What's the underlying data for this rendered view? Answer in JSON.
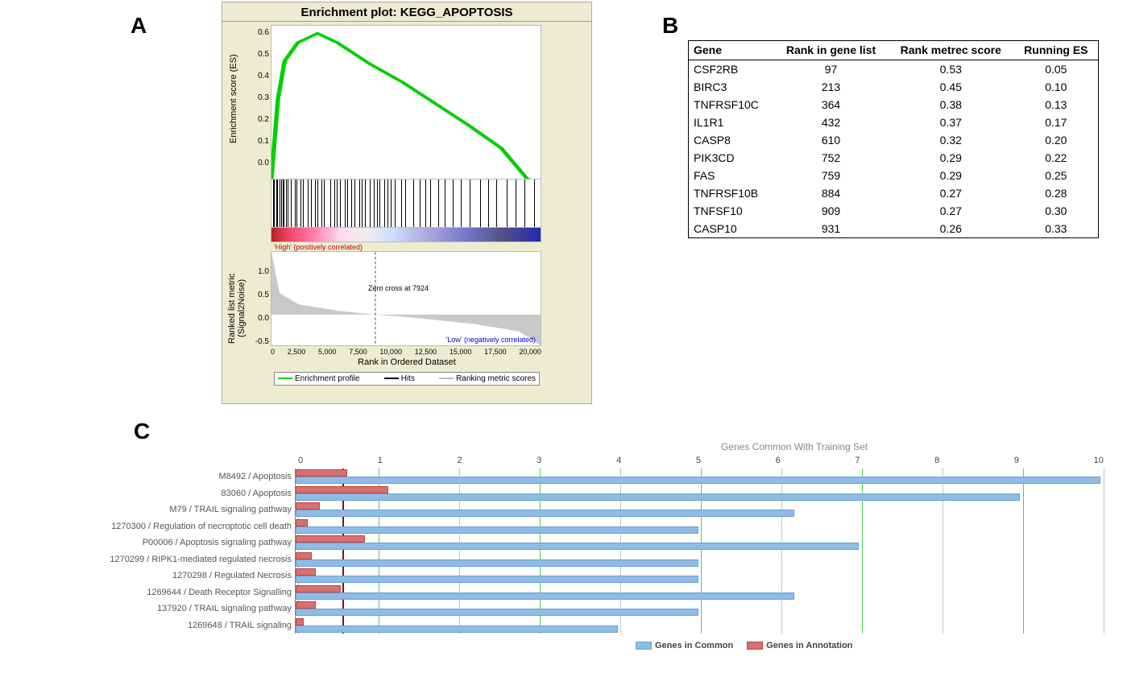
{
  "labels": {
    "A": "A",
    "B": "B",
    "C": "C"
  },
  "panelA": {
    "title": "Enrichment plot: KEGG_APOPTOSIS",
    "y1": "Enrichment score (ES)",
    "y2": "Ranked list metric (Signal2Noise)",
    "xlabel": "Rank in Ordered Dataset",
    "high": "'High' (positively correlated)",
    "low": "'Low' (negatively correlated)",
    "zero": "Zero cross at 7924",
    "legend": {
      "a": "Enrichment profile",
      "b": "Hits",
      "c": "Ranking metric scores"
    },
    "y1ticks": [
      "0.6",
      "0.5",
      "0.4",
      "0.3",
      "0.2",
      "0.1",
      "0.0"
    ],
    "y2ticks": [
      "1.0",
      "0.5",
      "0.0",
      "-0.5"
    ],
    "xticks": [
      "0",
      "2,500",
      "5,000",
      "7,500",
      "10,000",
      "12,500",
      "15,000",
      "17,500",
      "20,000"
    ]
  },
  "panelB": {
    "headers": [
      "Gene",
      "Rank in gene list",
      "Rank metrec score",
      "Running ES"
    ],
    "rows": [
      [
        "CSF2RB",
        "97",
        "0.53",
        "0.05"
      ],
      [
        "BIRC3",
        "213",
        "0.45",
        "0.10"
      ],
      [
        "TNFRSF10C",
        "364",
        "0.38",
        "0.13"
      ],
      [
        "IL1R1",
        "432",
        "0.37",
        "0.17"
      ],
      [
        "CASP8",
        "610",
        "0.32",
        "0.20"
      ],
      [
        "PIK3CD",
        "752",
        "0.29",
        "0.22"
      ],
      [
        "FAS",
        "759",
        "0.29",
        "0.25"
      ],
      [
        "TNFRSF10B",
        "884",
        "0.27",
        "0.28"
      ],
      [
        "TNFSF10",
        "909",
        "0.27",
        "0.30"
      ],
      [
        "CASP10",
        "931",
        "0.26",
        "0.33"
      ]
    ]
  },
  "panelC": {
    "title": "Genes Common With Training Set",
    "xticks": [
      "0",
      "1",
      "2",
      "3",
      "4",
      "5",
      "6",
      "7",
      "8",
      "9",
      "10"
    ],
    "cutoff": 0.55,
    "legend": {
      "blue": "Genes in Common",
      "red": "Genes in Annotation"
    },
    "rows": [
      {
        "label": "M8492 / Apoptosis",
        "blue": 10.0,
        "red": 0.64
      },
      {
        "label": "83060 / Apoptosis",
        "blue": 9.0,
        "red": 1.15
      },
      {
        "label": "M79 / TRAIL signaling pathway",
        "blue": 6.2,
        "red": 0.3
      },
      {
        "label": "1270300 / Regulation of necroptotic cell death",
        "blue": 5.0,
        "red": 0.15
      },
      {
        "label": "P00006 / Apoptosis signaling pathway",
        "blue": 7.0,
        "red": 0.86
      },
      {
        "label": "1270299 / RIPK1-mediated regulated necrosis",
        "blue": 5.0,
        "red": 0.2
      },
      {
        "label": "1270298 / Regulated Necrosis",
        "blue": 5.0,
        "red": 0.25
      },
      {
        "label": "1269644 / Death Receptor Signalling",
        "blue": 6.2,
        "red": 0.56
      },
      {
        "label": "137920 / TRAIL signaling pathway",
        "blue": 5.0,
        "red": 0.25
      },
      {
        "label": "1269648 / TRAIL signaling",
        "blue": 4.0,
        "red": 0.1
      }
    ]
  },
  "chart_data": [
    {
      "panel": "A",
      "type": "line",
      "title": "Enrichment plot: KEGG_APOPTOSIS",
      "x_range": [
        0,
        20500
      ],
      "y_range": [
        0,
        0.65
      ],
      "ylabel": "Enrichment score (ES)",
      "enrichment_profile": [
        [
          0,
          0.0
        ],
        [
          500,
          0.34
        ],
        [
          1000,
          0.5
        ],
        [
          2000,
          0.58
        ],
        [
          3500,
          0.62
        ],
        [
          5000,
          0.58
        ],
        [
          7500,
          0.49
        ],
        [
          10000,
          0.41
        ],
        [
          12500,
          0.32
        ],
        [
          15000,
          0.23
        ],
        [
          17500,
          0.13
        ],
        [
          19500,
          0.0
        ],
        [
          20500,
          -0.02
        ]
      ],
      "ranked_metric": {
        "ylabel": "Ranked list metric (Signal2Noise)",
        "y_range": [
          -0.6,
          1.2
        ],
        "zero_cross": 7924,
        "points": [
          [
            0,
            1.2
          ],
          [
            1000,
            0.4
          ],
          [
            3000,
            0.15
          ],
          [
            7924,
            0.0
          ],
          [
            15000,
            -0.15
          ],
          [
            19000,
            -0.35
          ],
          [
            20500,
            -0.6
          ]
        ]
      },
      "hit_ranks": [
        97,
        213,
        364,
        432,
        610,
        752,
        759,
        884,
        909,
        931,
        1100,
        1250,
        1480,
        1750,
        1900,
        2200,
        2400,
        2750,
        3000,
        3300,
        3500,
        3800,
        4000,
        4500,
        4800,
        5000,
        5200,
        5600,
        5800,
        6100,
        6300,
        6700,
        6900,
        7100,
        7500,
        7800,
        8050,
        8200,
        8600,
        8850,
        9100,
        9400,
        9900,
        10200,
        10800,
        11300,
        11700,
        12100,
        12700,
        13200,
        13800,
        14400,
        15100,
        15900,
        16500,
        17100,
        17900,
        18600,
        19300,
        20000
      ]
    },
    {
      "panel": "B",
      "type": "table",
      "columns": [
        "Gene",
        "Rank in gene list",
        "Rank metrec score",
        "Running ES"
      ],
      "rows": [
        [
          "CSF2RB",
          97,
          0.53,
          0.05
        ],
        [
          "BIRC3",
          213,
          0.45,
          0.1
        ],
        [
          "TNFRSF10C",
          364,
          0.38,
          0.13
        ],
        [
          "IL1R1",
          432,
          0.37,
          0.17
        ],
        [
          "CASP8",
          610,
          0.32,
          0.2
        ],
        [
          "PIK3CD",
          752,
          0.29,
          0.22
        ],
        [
          "FAS",
          759,
          0.29,
          0.25
        ],
        [
          "TNFRSF10B",
          884,
          0.27,
          0.28
        ],
        [
          "TNFSF10",
          909,
          0.27,
          0.3
        ],
        [
          "CASP10",
          931,
          0.26,
          0.33
        ]
      ]
    },
    {
      "panel": "C",
      "type": "bar",
      "orientation": "horizontal",
      "title": "Genes Common With Training Set",
      "xlabel": "Genes Common With Training Set",
      "xlim": [
        0,
        10
      ],
      "categories": [
        "M8492 / Apoptosis",
        "83060 / Apoptosis",
        "M79 / TRAIL signaling pathway",
        "1270300 / Regulation of necroptotic cell death",
        "P00006 / Apoptosis signaling pathway",
        "1270299 / RIPK1-mediated regulated necrosis",
        "1270298 / Regulated Necrosis",
        "1269644 / Death Receptor Signalling",
        "137920 / TRAIL signaling pathway",
        "1269648 / TRAIL signaling"
      ],
      "series": [
        {
          "name": "Genes in Common",
          "color": "#8fbce6",
          "values": [
            10.0,
            9.0,
            6.2,
            5.0,
            7.0,
            5.0,
            5.0,
            6.2,
            5.0,
            4.0
          ]
        },
        {
          "name": "Genes in Annotation",
          "color": "#d87070",
          "values": [
            0.64,
            1.15,
            0.3,
            0.15,
            0.86,
            0.2,
            0.25,
            0.56,
            0.25,
            0.1
          ]
        }
      ],
      "reference_line": 0.55
    }
  ]
}
